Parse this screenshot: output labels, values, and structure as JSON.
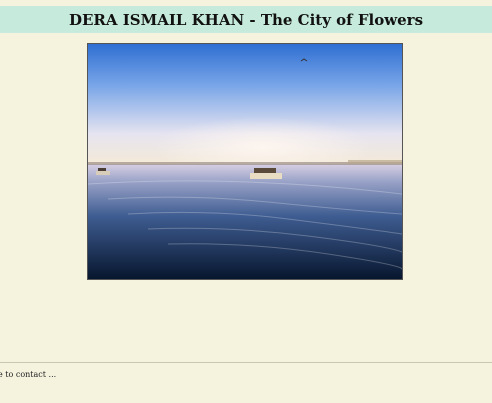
{
  "header": {
    "title": "DERA ISMAIL KHAN - The City of Flowers"
  },
  "main_image": {
    "subject": "river-with-boats-photo"
  },
  "footer": {
    "text": "e to contact ..."
  }
}
